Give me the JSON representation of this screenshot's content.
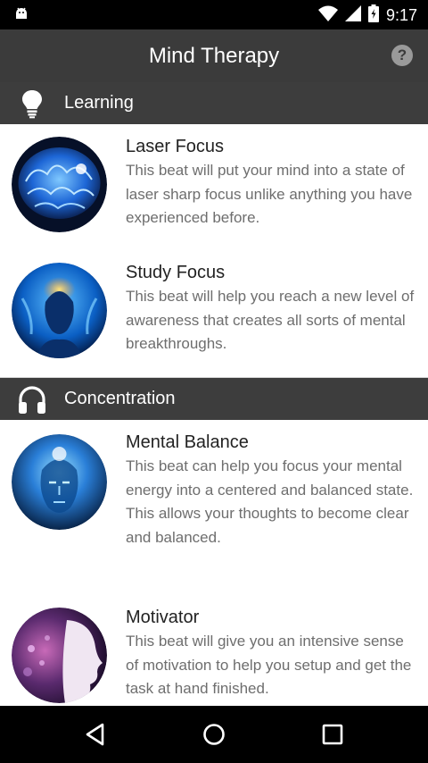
{
  "status_bar": {
    "time": "9:17",
    "icons": [
      "android-icon",
      "wifi-icon",
      "signal-icon",
      "battery-icon"
    ]
  },
  "app_bar": {
    "title": "Mind Therapy",
    "help_label": "?"
  },
  "sections": [
    {
      "label": "Learning",
      "icon": "lightbulb-icon",
      "items": [
        {
          "title": "Laser Focus",
          "description": "This beat will put your mind into a state of laser sharp focus unlike anything you have experienced before.",
          "image": "blue-brain-thumbnail"
        },
        {
          "title": "Study Focus",
          "description": "This beat will help you reach a new level of awareness that creates all sorts of mental breakthroughs.",
          "image": "glowing-head-thumbnail"
        }
      ]
    },
    {
      "label": "Concentration",
      "icon": "headphones-icon",
      "items": [
        {
          "title": "Mental Balance",
          "description": "This beat can help you focus your mental energy into a centered and balanced state. This allows your thoughts to become clear and balanced.",
          "image": "digital-face-thumbnail"
        },
        {
          "title": "Motivator",
          "description": "This beat will give you an intensive sense of motivation to help you setup and get the task at hand finished.",
          "image": "profile-head-thumbnail"
        }
      ]
    }
  ],
  "nav_bar": {
    "buttons": [
      "back-icon",
      "home-icon",
      "recents-icon"
    ]
  }
}
